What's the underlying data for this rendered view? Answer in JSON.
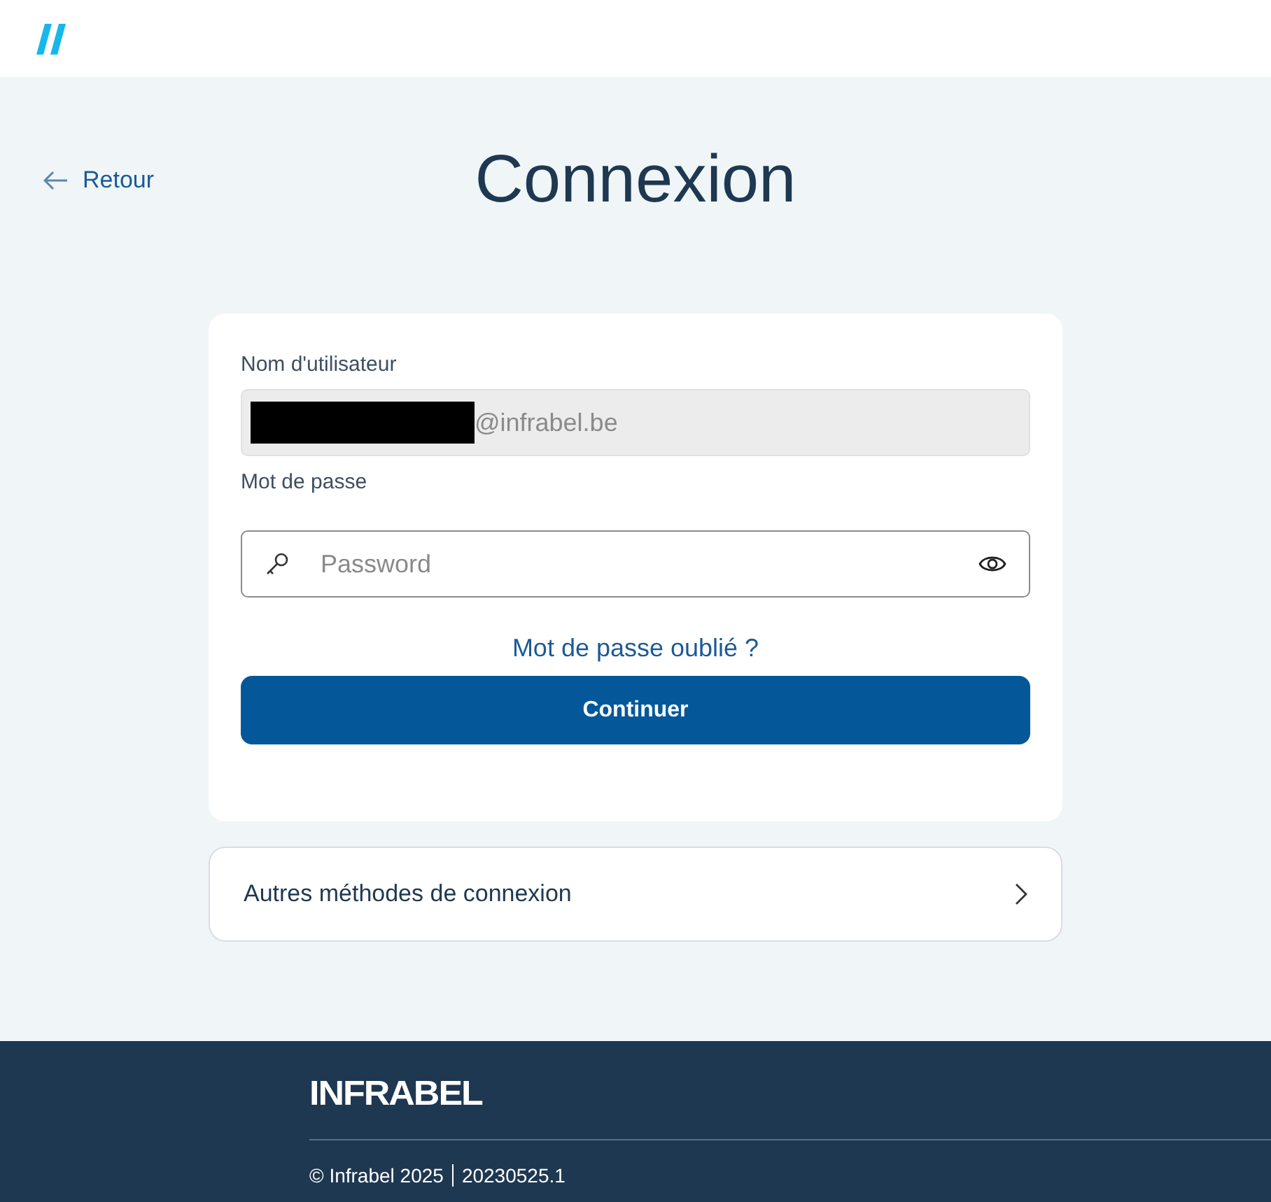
{
  "back_link": {
    "label": "Retour"
  },
  "title": "Connexion",
  "login_form": {
    "username": {
      "label": "Nom d'utilisateur",
      "value": "@infrabel.be",
      "redacted": true,
      "disabled": true
    },
    "password": {
      "label": "Mot de passe",
      "placeholder": "Password"
    },
    "forgot_link": "Mot de passe oublié ?",
    "submit": "Continuer"
  },
  "other_methods": {
    "label": "Autres méthodes de connexion"
  },
  "footer": {
    "logo": "INFRABEL",
    "copyright": "© Infrabel 2025",
    "version": "20230525.1"
  }
}
